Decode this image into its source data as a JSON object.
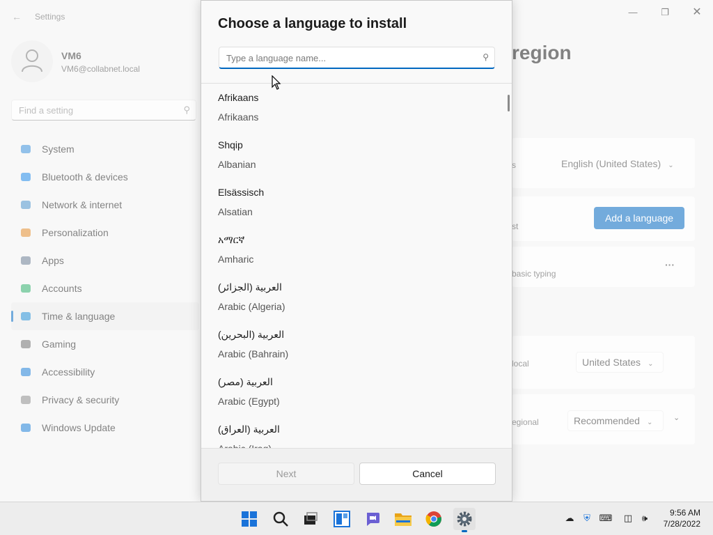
{
  "settings": {
    "window_title": "Settings",
    "profile": {
      "name": "VM6",
      "email": "VM6@collabnet.local"
    },
    "search_placeholder": "Find a setting",
    "nav": [
      {
        "label": "System",
        "icon": "system-icon",
        "color": "#3a8fd9",
        "selected": false
      },
      {
        "label": "Bluetooth & devices",
        "icon": "bluetooth-icon",
        "color": "#1e88e5",
        "selected": false
      },
      {
        "label": "Network & internet",
        "icon": "wifi-icon",
        "color": "#4a90c8",
        "selected": false
      },
      {
        "label": "Personalization",
        "icon": "brush-icon",
        "color": "#e08a2c",
        "selected": false
      },
      {
        "label": "Apps",
        "icon": "apps-icon",
        "color": "#6b7c93",
        "selected": false
      },
      {
        "label": "Accounts",
        "icon": "accounts-icon",
        "color": "#2fae6a",
        "selected": false
      },
      {
        "label": "Time & language",
        "icon": "globe-clock-icon",
        "color": "#1f8ad2",
        "selected": true
      },
      {
        "label": "Gaming",
        "icon": "gaming-icon",
        "color": "#707070",
        "selected": false
      },
      {
        "label": "Accessibility",
        "icon": "accessibility-icon",
        "color": "#1e7fd6",
        "selected": false
      },
      {
        "label": "Privacy & security",
        "icon": "shield-icon",
        "color": "#8a8a8a",
        "selected": false
      },
      {
        "label": "Windows Update",
        "icon": "update-icon",
        "color": "#1d7ed6",
        "selected": false
      }
    ],
    "page_heading_fragment": "region",
    "partial": {
      "s_text": "s",
      "display_language": "English (United States)",
      "st_text": "st",
      "add_language": "Add a language",
      "basic_typing": "basic typing",
      "local_text": "local",
      "country": "United States",
      "regional_text": "egional",
      "format": "Recommended"
    }
  },
  "dialog": {
    "title": "Choose a language to install",
    "search_placeholder": "Type a language name...",
    "languages": [
      {
        "native": "Afrikaans",
        "english": "Afrikaans"
      },
      {
        "native": "Shqip",
        "english": "Albanian"
      },
      {
        "native": "Elsässisch",
        "english": "Alsatian"
      },
      {
        "native": "አማርኛ",
        "english": "Amharic"
      },
      {
        "native": "العربية (الجزائر)",
        "english": "Arabic (Algeria)"
      },
      {
        "native": "العربية (البحرين)",
        "english": "Arabic (Bahrain)"
      },
      {
        "native": "العربية (مصر)",
        "english": "Arabic (Egypt)"
      },
      {
        "native": "العربية (العراق)",
        "english": "Arabic (Iraq)"
      }
    ],
    "next_label": "Next",
    "cancel_label": "Cancel"
  },
  "taskbar": {
    "apps": [
      "start-icon",
      "search-icon",
      "task-view-icon",
      "widgets-icon",
      "chat-icon",
      "file-explorer-icon",
      "chrome-icon",
      "settings-gear-icon"
    ],
    "time": "9:56 AM",
    "date": "7/28/2022"
  }
}
